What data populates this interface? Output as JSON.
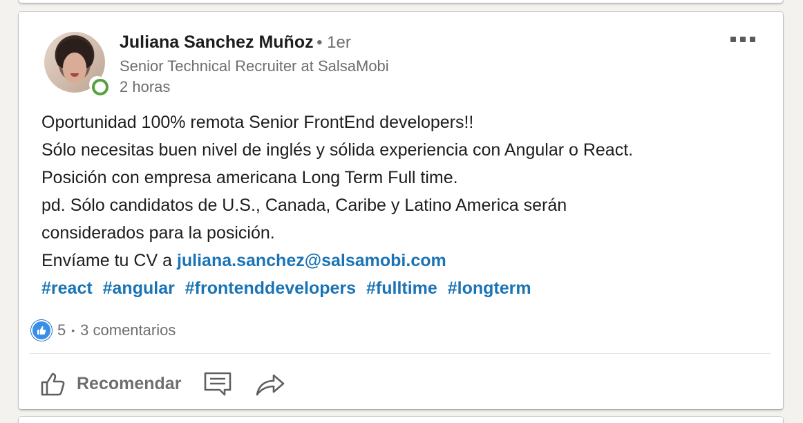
{
  "post": {
    "author": {
      "name": "Juliana Sanchez Muñoz",
      "degree": "• 1er",
      "headline": "Senior Technical Recruiter at SalsaMobi",
      "time": "2 horas",
      "avatar_icon": "profile-photo",
      "presence_color": "#57a03e"
    },
    "menu_icon": "ellipsis-icon",
    "body": {
      "line1": "Oportunidad 100% remota Senior FrontEnd developers!!",
      "line2": "Sólo necesitas buen nivel de inglés y sólida experiencia con Angular o React.",
      "line3": "Posición con empresa americana Long Term Full time.",
      "line4": "pd. Sólo candidatos de U.S., Canada, Caribe y Latino America serán",
      "line5": "considerados para la posición.",
      "line6_prefix": "Envíame tu CV a ",
      "email": "juliana.sanchez@salsamobi.com",
      "hashtags": [
        "#react",
        "#angular",
        "#frontenddevelopers",
        "#fulltime",
        "#longterm"
      ]
    },
    "social": {
      "reaction_icon": "like-icon",
      "reaction_count": "5",
      "separator": "•",
      "comments": "3 comentarios"
    },
    "actions": {
      "recommend_label": "Recomendar",
      "recommend_icon": "thumbs-up-icon",
      "comment_icon": "comment-icon",
      "share_icon": "share-icon"
    },
    "colors": {
      "link": "#1a73b5",
      "text": "#1d1d1d",
      "muted": "#6e6e6e",
      "like": "#378fe9"
    }
  }
}
